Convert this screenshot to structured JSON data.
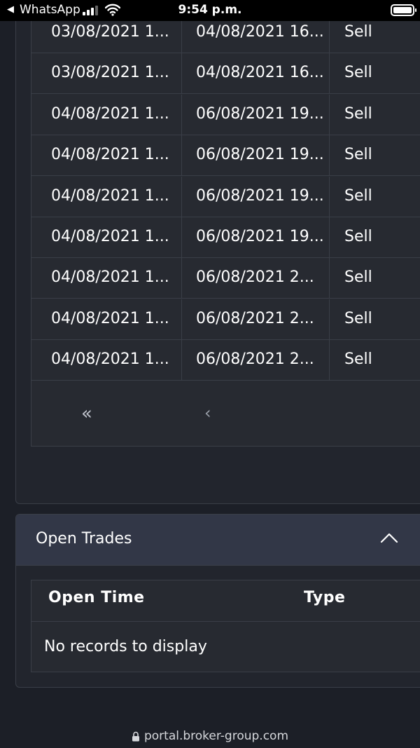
{
  "status_bar": {
    "back_app": "WhatsApp",
    "time": "9:54 p.m."
  },
  "closed_trades": {
    "rows": [
      {
        "open_time": "03/08/2021 1...",
        "close_time": "04/08/2021 16...",
        "type": "Sell"
      },
      {
        "open_time": "03/08/2021 1...",
        "close_time": "04/08/2021 16...",
        "type": "Sell"
      },
      {
        "open_time": "04/08/2021 1...",
        "close_time": "06/08/2021 19...",
        "type": "Sell"
      },
      {
        "open_time": "04/08/2021 1...",
        "close_time": "06/08/2021 19...",
        "type": "Sell"
      },
      {
        "open_time": "04/08/2021 1...",
        "close_time": "06/08/2021 19...",
        "type": "Sell"
      },
      {
        "open_time": "04/08/2021 1...",
        "close_time": "06/08/2021 19...",
        "type": "Sell"
      },
      {
        "open_time": "04/08/2021 1...",
        "close_time": "06/08/2021 2...",
        "type": "Sell"
      },
      {
        "open_time": "04/08/2021 1...",
        "close_time": "06/08/2021 2...",
        "type": "Sell"
      },
      {
        "open_time": "04/08/2021 1...",
        "close_time": "06/08/2021 2...",
        "type": "Sell"
      }
    ],
    "pager": {
      "first": "«",
      "prev": "‹"
    }
  },
  "open_trades": {
    "title": "Open Trades",
    "columns": [
      "Open Time",
      "Type"
    ],
    "empty_message": "No records to display"
  },
  "url_bar": {
    "url": "portal.broker-group.com"
  },
  "colors": {
    "background": "#1c1f27",
    "panel": "#22252d",
    "header": "#323747",
    "border": "#3a3e47"
  }
}
